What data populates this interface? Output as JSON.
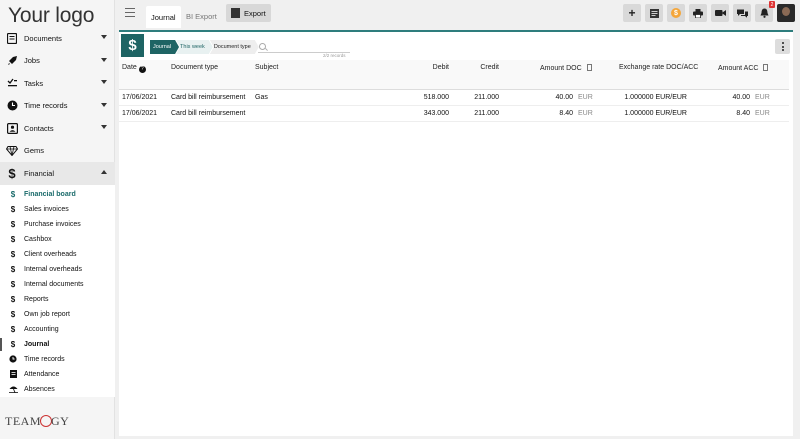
{
  "app": {
    "logo": "Your logo",
    "brand": [
      "TEAM",
      "GY"
    ]
  },
  "topbar": {
    "tabs": [
      {
        "label": "Journal"
      },
      {
        "label": "BI Export"
      }
    ],
    "export_label": "Export",
    "notification_count": "2"
  },
  "sidebar": {
    "items": [
      {
        "label": "Documents"
      },
      {
        "label": "Jobs"
      },
      {
        "label": "Tasks"
      },
      {
        "label": "Time records"
      },
      {
        "label": "Contacts"
      },
      {
        "label": "Gems"
      },
      {
        "label": "Financial"
      }
    ],
    "financial_sub": [
      {
        "label": "Financial board"
      },
      {
        "label": "Sales invoices"
      },
      {
        "label": "Purchase invoices"
      },
      {
        "label": "Cashbox"
      },
      {
        "label": "Client overheads"
      },
      {
        "label": "Internal overheads"
      },
      {
        "label": "Internal documents"
      },
      {
        "label": "Reports"
      },
      {
        "label": "Own job report"
      },
      {
        "label": "Accounting"
      },
      {
        "label": "Journal"
      },
      {
        "label": "Time records"
      },
      {
        "label": "Attendance"
      },
      {
        "label": "Absences"
      }
    ]
  },
  "content": {
    "breadcrumbs": [
      "Journal",
      "This week",
      "Document type"
    ],
    "records": "2/2 records",
    "columns": {
      "date": "Date",
      "doc_type": "Document type",
      "subject": "Subject",
      "debit": "Debit",
      "credit": "Credit",
      "amount_doc": "Amount DOC",
      "exchange": "Exchange rate DOC/ACC",
      "amount_acc": "Amount ACC"
    },
    "rows": [
      {
        "date": "17/06/2021",
        "doc_type": "Card bill reimbursement",
        "subject": "Gas",
        "debit": "518.000",
        "credit": "211.000",
        "amount_doc": "40.00",
        "cur_doc": "EUR",
        "exchange": "1.000000 EUR/EUR",
        "amount_acc": "40.00",
        "cur_acc": "EUR"
      },
      {
        "date": "17/06/2021",
        "doc_type": "Card bill reimbursement",
        "subject": "",
        "debit": "343.000",
        "credit": "211.000",
        "amount_doc": "8.40",
        "cur_doc": "EUR",
        "exchange": "1.000000 EUR/EUR",
        "amount_acc": "8.40",
        "cur_acc": "EUR"
      }
    ]
  }
}
